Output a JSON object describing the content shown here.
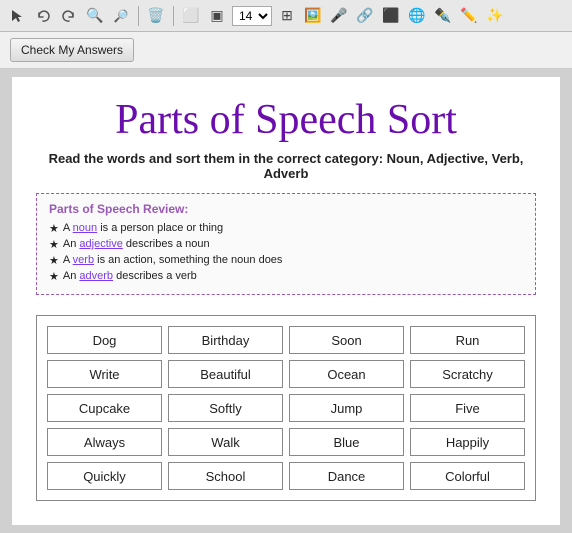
{
  "toolbar": {
    "check_btn_label": "Check My Answers"
  },
  "page": {
    "title": "Parts of Speech Sort",
    "subtitle": "Read the words and sort them in the correct category: Noun, Adjective, Verb, Adverb",
    "review": {
      "title": "Parts of Speech Review:",
      "items": [
        {
          "prefix": "A ",
          "link": "noun",
          "text": " is a person place or thing"
        },
        {
          "prefix": "An ",
          "link": "adjective",
          "text": " describes a noun"
        },
        {
          "prefix": "A ",
          "link": "verb",
          "text": " is an action, something the noun does"
        },
        {
          "prefix": "An ",
          "link": "adverb",
          "text": " describes a verb"
        }
      ]
    },
    "words": [
      [
        "Dog",
        "Birthday",
        "Soon",
        "Run"
      ],
      [
        "Write",
        "Beautiful",
        "Ocean",
        "Scratchy"
      ],
      [
        "Cupcake",
        "Softly",
        "Jump",
        "Five"
      ],
      [
        "Always",
        "Walk",
        "Blue",
        "Happily"
      ],
      [
        "Quickly",
        "School",
        "Dance",
        "Colorful"
      ]
    ]
  }
}
